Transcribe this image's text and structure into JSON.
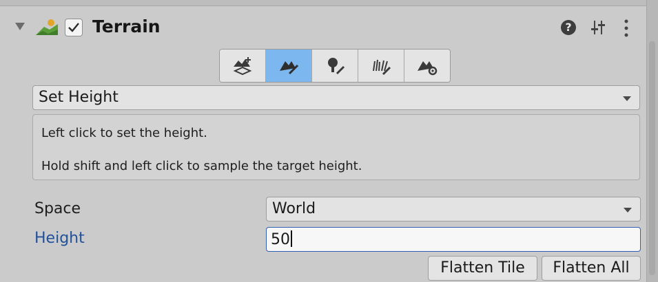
{
  "component": {
    "title": "Terrain",
    "enabled": true,
    "icons": [
      "foldout-triangle-icon",
      "terrain-icon",
      "help-icon",
      "presets-icon",
      "kebab-menu-icon"
    ]
  },
  "toolbar": {
    "tools": [
      {
        "name": "create-neighbor-terrains-icon",
        "active": false
      },
      {
        "name": "paint-terrain-icon",
        "active": true
      },
      {
        "name": "paint-trees-icon",
        "active": false
      },
      {
        "name": "paint-details-icon",
        "active": false
      },
      {
        "name": "terrain-settings-icon",
        "active": false
      }
    ]
  },
  "brush_tool": {
    "selected": "Set Height"
  },
  "help": {
    "line1": "Left click to set the height.",
    "line2": "Hold shift and left click to sample the target height."
  },
  "fields": {
    "space_label": "Space",
    "space_value": "World",
    "height_label": "Height",
    "height_value": "50"
  },
  "buttons": {
    "flatten_tile": "Flatten Tile",
    "flatten_all": "Flatten All"
  },
  "colors": {
    "active_tool": "#7cb7ef",
    "focused_field_border": "#2f5fb3",
    "label_highlight": "#21519b"
  }
}
